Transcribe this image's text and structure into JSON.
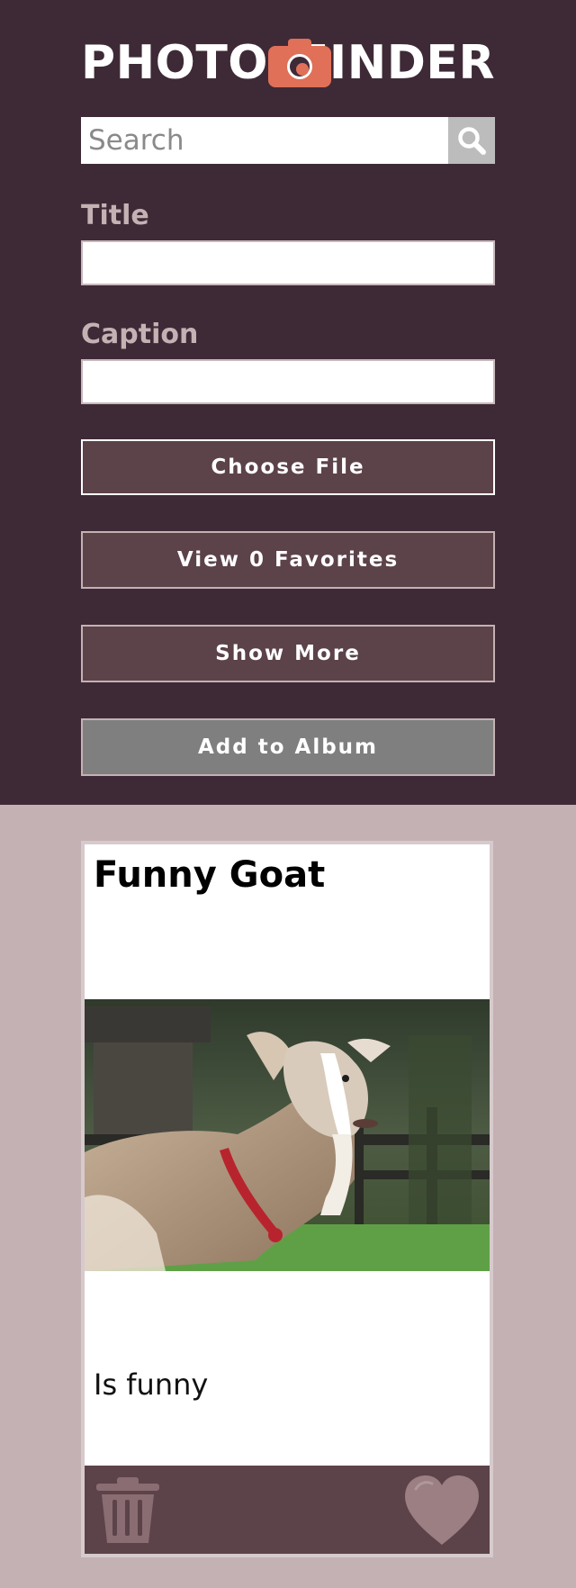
{
  "app": {
    "logo_left": "PHOTO",
    "logo_right": "FINDER",
    "logo_icon": "camera-icon"
  },
  "search": {
    "placeholder": "Search",
    "value": "",
    "icon": "search-icon"
  },
  "form": {
    "title_label": "Title",
    "title_value": "",
    "caption_label": "Caption",
    "caption_value": ""
  },
  "buttons": {
    "choose_file": "Choose File",
    "view_favorites": "View 0 Favorites",
    "show_more": "Show More",
    "add_to_album": "Add to Album"
  },
  "cards": [
    {
      "title": "Funny Goat",
      "caption": "Is funny",
      "image_alt": "goat photo",
      "delete_icon": "trash-icon",
      "favorite_icon": "heart-icon"
    }
  ],
  "colors": {
    "header_bg": "#3e2a36",
    "page_bg": "#c4b1b4",
    "button_bg": "#5c4249",
    "accent": "#e07058",
    "disabled_button_bg": "#7f7f7f"
  }
}
